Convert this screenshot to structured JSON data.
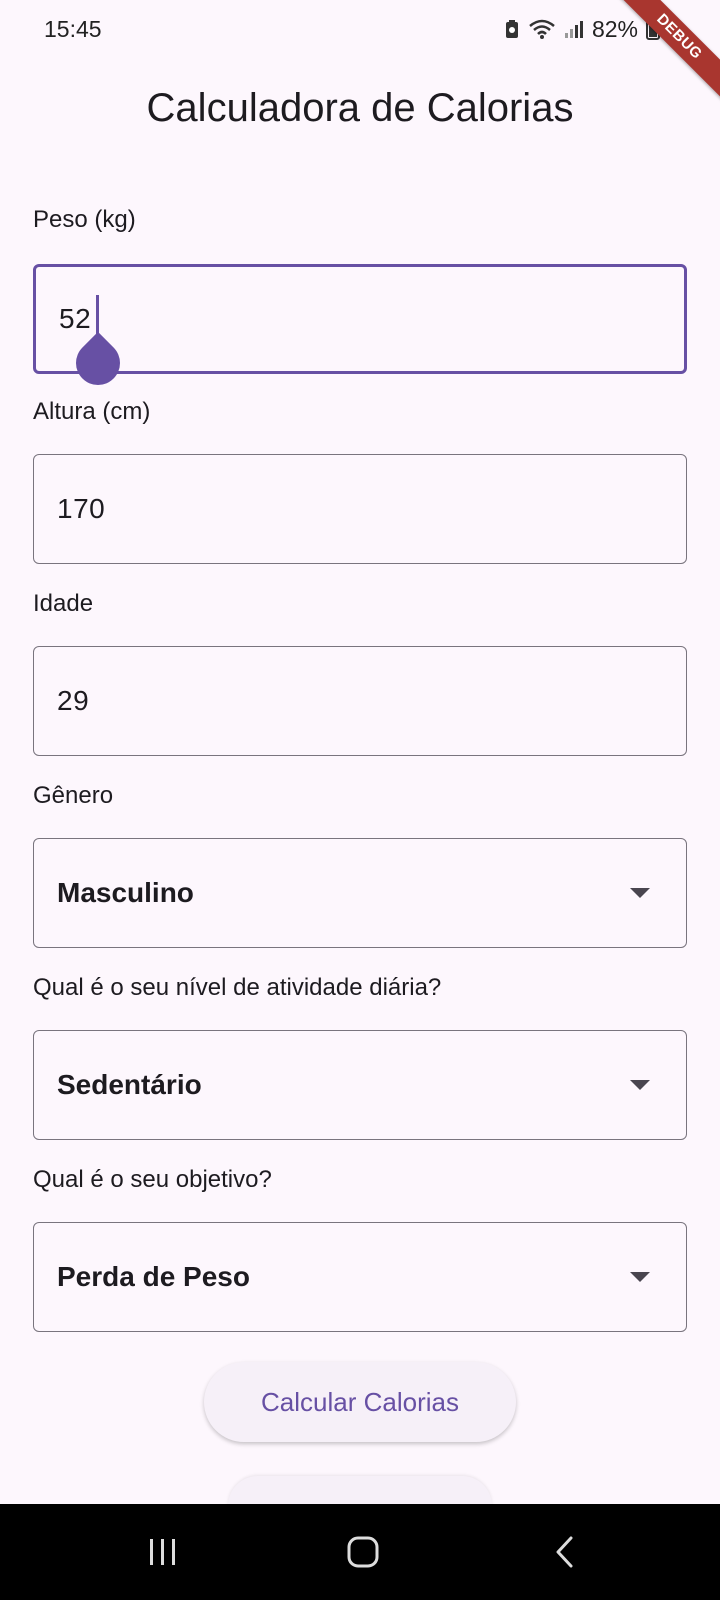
{
  "status_bar": {
    "time": "15:45",
    "battery": "82%",
    "debug_banner": "DEBUG"
  },
  "title": "Calculadora de Calorias",
  "fields": {
    "peso": {
      "label": "Peso (kg)",
      "value": "52"
    },
    "altura": {
      "label": "Altura (cm)",
      "value": "170"
    },
    "idade": {
      "label": "Idade",
      "value": "29"
    }
  },
  "dropdowns": {
    "genero": {
      "label": "Gênero",
      "selected": "Masculino"
    },
    "atividade": {
      "label": "Qual é o seu nível de atividade diária?",
      "selected": "Sedentário"
    },
    "objetivo": {
      "label": "Qual é o seu objetivo?",
      "selected": "Perda de Peso"
    }
  },
  "buttons": {
    "calcular": "Calcular Calorias"
  },
  "colors": {
    "accent": "#6750a4",
    "background": "#fdf7fd",
    "outline": "#79747e",
    "debug_ribbon": "#a9362f"
  },
  "icons": {
    "status": [
      "battery-saver-icon",
      "wifi-icon",
      "signal-icon",
      "battery-icon"
    ],
    "dropdown": "arrow-drop-down-icon",
    "nav": [
      "recents-icon",
      "home-icon",
      "back-icon"
    ]
  }
}
